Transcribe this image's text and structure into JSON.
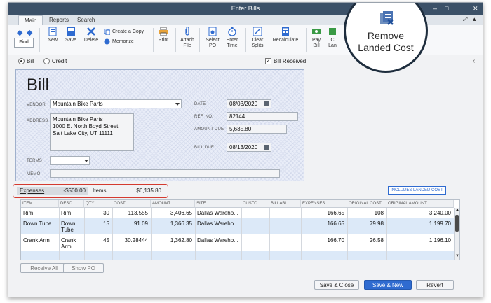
{
  "window": {
    "title": "Enter Bills"
  },
  "tabs": [
    "Main",
    "Reports",
    "Search"
  ],
  "toolbar": {
    "find": "Find",
    "new": "New",
    "save": "Save",
    "delete": "Delete",
    "create_copy": "Create a Copy",
    "memorize": "Memorize",
    "print": "Print",
    "attach_file_1": "Attach",
    "attach_file_2": "File",
    "select_po_1": "Select",
    "select_po_2": "PO",
    "enter_time_1": "Enter",
    "enter_time_2": "Time",
    "clear_splits_1": "Clear",
    "clear_splits_2": "Splits",
    "recalculate": "Recalculate",
    "pay_bill_1": "Pay",
    "pay_bill_2": "Bill",
    "cut_1": "C",
    "cut_2": "Lan",
    "remove_landed_cost_1": "Remove",
    "remove_landed_cost_2": "Landed Cost"
  },
  "type_select": {
    "bill": "Bill",
    "credit": "Credit",
    "bill_received": "Bill Received"
  },
  "form": {
    "heading": "Bill",
    "vendor_label": "VENDOR",
    "vendor": "Mountain Bike Parts",
    "address_label": "ADDRESS",
    "address_line1": "Mountain Bike Parts",
    "address_line2": "1000 E. North Boyd Street",
    "address_line3": "Salt Lake City, UT 11111",
    "terms_label": "TERMS",
    "terms": "",
    "memo_label": "MEMO",
    "memo": "",
    "date_label": "DATE",
    "date": "08/03/2020",
    "ref_label": "REF. NO.",
    "ref": "82144",
    "amount_due_label": "AMOUNT DUE",
    "amount_due": "5,635.80",
    "bill_due_label": "BILL DUE",
    "bill_due": "08/13/2020"
  },
  "totals": {
    "expenses_label": "Expenses",
    "expenses_amount": "-$500.00",
    "items_label": "Items",
    "items_amount": "$6,135.80",
    "landed_cost_badge": "INCLUDES LANDED COST"
  },
  "table": {
    "headers": [
      "ITEM",
      "DESC...",
      "QTY",
      "COST",
      "AMOUNT",
      "SITE",
      "CUSTO...",
      "BILLABL...",
      "EXPENSES",
      "ORIGINAL COST",
      "ORIGINAL AMOUNT"
    ],
    "rows": [
      {
        "item": "Rim",
        "desc1": "Rim",
        "desc2": "",
        "qty": "30",
        "cost": "113.555",
        "amount": "3,406.65",
        "site": "Dallas Wareho...",
        "expenses": "166.65",
        "orig_cost": "108",
        "orig_amount": "3,240.00"
      },
      {
        "item": "Down Tube",
        "desc1": "Down",
        "desc2": "Tube",
        "qty": "15",
        "cost": "91.09",
        "amount": "1,366.35",
        "site": "Dallas Wareho...",
        "expenses": "166.65",
        "orig_cost": "79.98",
        "orig_amount": "1,199.70"
      },
      {
        "item": "Crank Arm",
        "desc1": "Crank",
        "desc2": "Arm",
        "qty": "45",
        "cost": "30.28444",
        "amount": "1,362.80",
        "site": "Dallas Wareho...",
        "expenses": "166.70",
        "orig_cost": "26.58",
        "orig_amount": "1,196.10"
      }
    ]
  },
  "buttons": {
    "receive_all": "Receive All",
    "show_po": "Show PO",
    "save_close": "Save & Close",
    "save_new": "Save & New",
    "revert": "Revert"
  },
  "colors": {
    "titlebar": "#3c5168",
    "accent": "#2f6bd0",
    "highlight_red": "#d43a2f"
  }
}
